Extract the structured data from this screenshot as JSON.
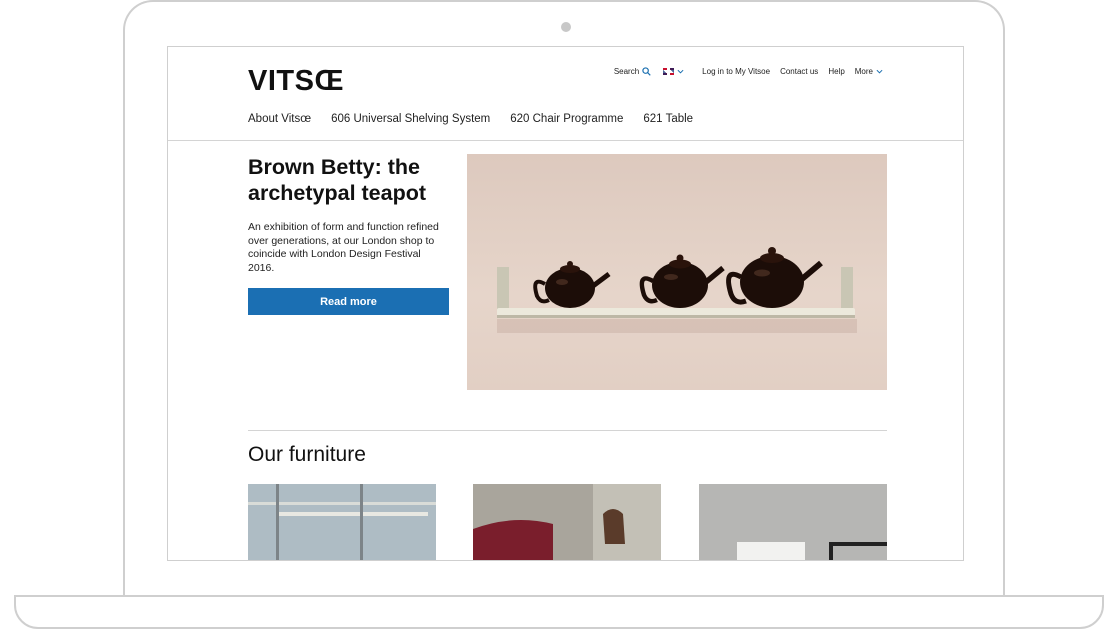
{
  "header": {
    "logo": "VITSŒ",
    "utility": {
      "search_label": "Search",
      "login_label": "Log in to My Vitsoe",
      "contact_label": "Contact us",
      "help_label": "Help",
      "more_label": "More"
    },
    "nav": [
      {
        "label": "About Vitsœ"
      },
      {
        "label": "606 Universal Shelving System"
      },
      {
        "label": "620 Chair Programme"
      },
      {
        "label": "621 Table"
      }
    ]
  },
  "hero": {
    "title": "Brown Betty: the archetypal teapot",
    "text": "An exhibition of form and function refined over generations, at our London shop to coincide with London Design Festival 2016.",
    "button_label": "Read more"
  },
  "furniture": {
    "title": "Our furniture"
  },
  "colors": {
    "accent": "#1b6fb3",
    "text": "#111111",
    "rule": "#d4d4d4"
  },
  "icons": {
    "search": "search-icon",
    "language": "uk-flag-icon",
    "dropdown": "chevron-down-icon"
  }
}
